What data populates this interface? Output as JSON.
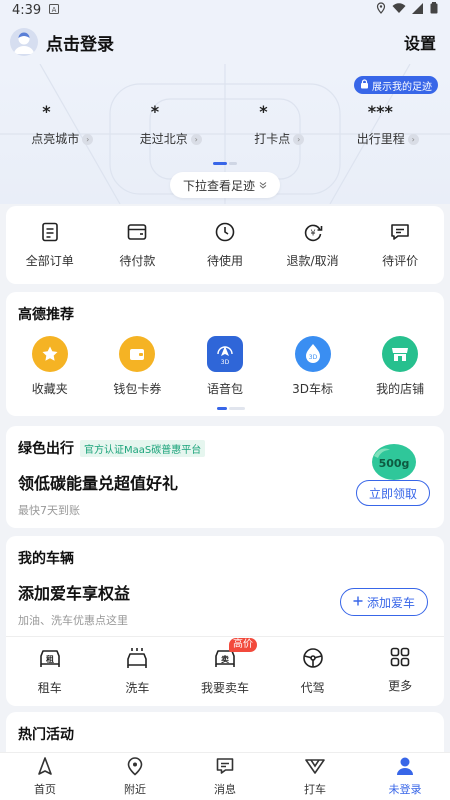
{
  "status": {
    "time": "4:39"
  },
  "header": {
    "login_label": "点击登录",
    "settings_label": "设置"
  },
  "footprint": {
    "button_label": "展示我的足迹",
    "stats": [
      {
        "value": "*",
        "label": "点亮城市"
      },
      {
        "value": "*",
        "label": "走过北京"
      },
      {
        "value": "*",
        "label": "打卡点"
      },
      {
        "value": "***",
        "label": "出行里程"
      }
    ],
    "pull_hint": "下拉查看足迹"
  },
  "orders": [
    {
      "label": "全部订单",
      "icon": "document-icon"
    },
    {
      "label": "待付款",
      "icon": "wallet-icon"
    },
    {
      "label": "待使用",
      "icon": "clock-icon"
    },
    {
      "label": "退款/取消",
      "icon": "refund-icon"
    },
    {
      "label": "待评价",
      "icon": "comment-icon"
    }
  ],
  "recommend": {
    "title": "高德推荐",
    "items": [
      {
        "label": "收藏夹",
        "icon": "star-icon",
        "color": "#f5b324"
      },
      {
        "label": "钱包卡券",
        "icon": "wallet-icon",
        "color": "#f5b324"
      },
      {
        "label": "语音包",
        "icon": "voice-pack-icon",
        "color": "#2f66d8",
        "badge": "3D"
      },
      {
        "label": "3D车标",
        "icon": "3d-car-icon",
        "color": "#3a8ef2",
        "badge": "3D"
      },
      {
        "label": "我的店铺",
        "icon": "store-icon",
        "color": "#27c08e"
      }
    ]
  },
  "green": {
    "title": "绿色出行",
    "tag": "官方认证MaaS碳普惠平台",
    "main": "领低碳能量兑超值好礼",
    "sub": "最快7天到账",
    "badge": "500g",
    "claim_label": "立即领取"
  },
  "vehicle": {
    "title": "我的车辆",
    "main": "添加爱车享权益",
    "sub": "加油、洗车优惠点这里",
    "add_label": "添加爱车",
    "items": [
      {
        "label": "租车",
        "icon": "rent-car-icon",
        "icon_text": "租"
      },
      {
        "label": "洗车",
        "icon": "car-wash-icon"
      },
      {
        "label": "我要卖车",
        "icon": "sell-car-icon",
        "badge": "高价",
        "icon_text": "卖"
      },
      {
        "label": "代驾",
        "icon": "steering-wheel-icon"
      },
      {
        "label": "更多",
        "icon": "grid-icon"
      }
    ]
  },
  "hot": {
    "title": "热门活动"
  },
  "tabs": [
    {
      "label": "首页",
      "icon": "navigation-arrow-icon"
    },
    {
      "label": "附近",
      "icon": "location-pin-icon"
    },
    {
      "label": "消息",
      "icon": "message-icon"
    },
    {
      "label": "打车",
      "icon": "taxi-icon"
    },
    {
      "label": "未登录",
      "icon": "person-icon",
      "active": true
    }
  ],
  "colors": {
    "accent": "#3866e8",
    "green": "#1ba37a",
    "badge_red": "#f24a3c"
  }
}
